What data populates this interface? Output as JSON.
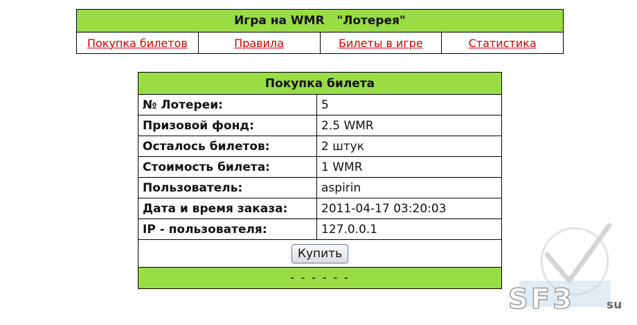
{
  "header": {
    "title": "Игра на WMR   \"Лотерея\""
  },
  "nav": {
    "items": [
      {
        "label": "Покупка билетов"
      },
      {
        "label": "Правила"
      },
      {
        "label": "Билеты в игре"
      },
      {
        "label": "Статистика"
      }
    ]
  },
  "purchase": {
    "title": "Покупка билета",
    "rows": [
      {
        "label": "№ Лотереи:",
        "value": "5"
      },
      {
        "label": "Призовой фонд:",
        "value": "2.5 WMR"
      },
      {
        "label": "Осталось билетов:",
        "value": "2 штук"
      },
      {
        "label": "Стоимость билета:",
        "value": "1 WMR"
      },
      {
        "label": "Пользователь:",
        "value": "aspirin"
      },
      {
        "label": "Дата и время заказа:",
        "value": "2011-04-17 03:20:03"
      },
      {
        "label": "IP - пользователя:",
        "value": "127.0.0.1"
      }
    ],
    "buy_label": "Купить",
    "footer": "- - - - - -"
  },
  "watermark": {
    "text": "SF3",
    "suffix": "su"
  },
  "colors": {
    "header_green": "#99dd44",
    "link_red": "#cc0000"
  }
}
